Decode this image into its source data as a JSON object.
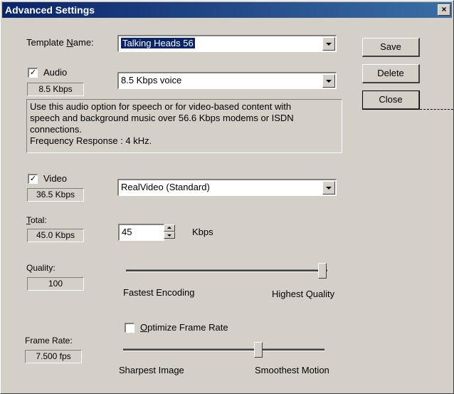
{
  "window": {
    "title": "Advanced Settings"
  },
  "template": {
    "label": "Template Name:",
    "value": "Talking Heads 56"
  },
  "buttons": {
    "save": "Save",
    "delete": "Delete",
    "close": "Close"
  },
  "audio": {
    "label": "Audio",
    "checked": true,
    "rate": "8.5 Kbps",
    "codec": "8.5 Kbps voice",
    "description": [
      "Use this audio option for speech or for video-based content with",
      "speech and background music over 56.6 Kbps modems or ISDN",
      "connections.",
      "Frequency Response : 4 kHz."
    ]
  },
  "video": {
    "label": "Video",
    "checked": true,
    "rate": "36.5 Kbps",
    "codec": "RealVideo (Standard)"
  },
  "total": {
    "label": "Total:",
    "rate": "45.0 Kbps",
    "value": "45",
    "unit": "Kbps"
  },
  "quality": {
    "label": "Quality:",
    "value": "100",
    "left_label": "Fastest Encoding",
    "right_label": "Highest Quality",
    "slider_level": 1.0
  },
  "frame_rate": {
    "optimize_label": "Optimize Frame Rate",
    "optimize_checked": false,
    "label": "Frame Rate:",
    "value": "7.500 fps",
    "left_label": "Sharpest Image",
    "right_label": "Smoothest Motion",
    "slider_level": 0.68
  },
  "icons": {
    "close": "close-icon",
    "dropdown": "chevron-down-icon",
    "check": "checkmark-icon"
  }
}
